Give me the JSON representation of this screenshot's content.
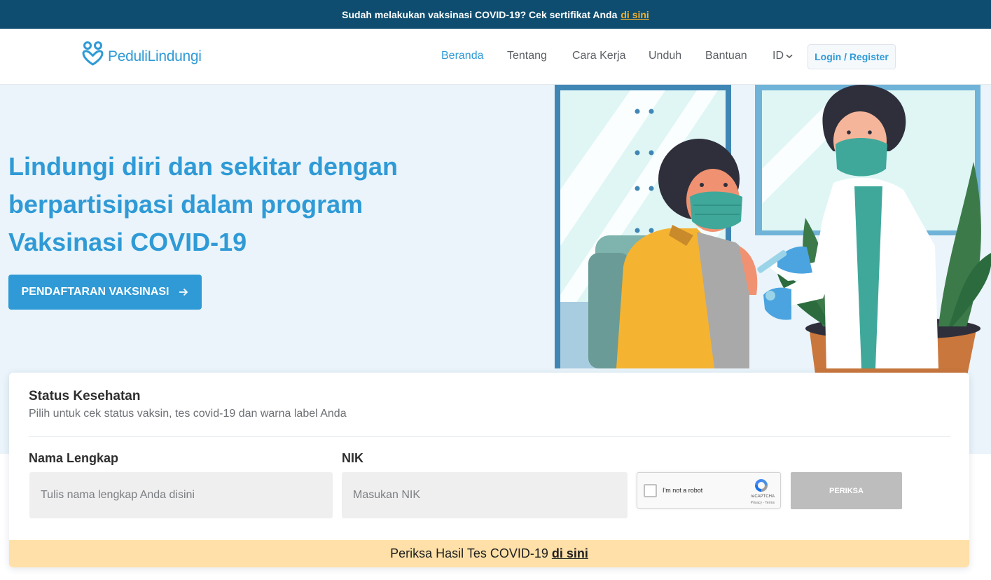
{
  "banner": {
    "text": "Sudah melakukan vaksinasi COVID-19? Cek sertifikat Anda",
    "link": "di sini"
  },
  "nav": {
    "brand": "PeduliLindungi",
    "items": [
      {
        "label": "Beranda",
        "active": true
      },
      {
        "label": "Tentang"
      },
      {
        "label": "Cara Kerja"
      },
      {
        "label": "Unduh"
      },
      {
        "label": "Bantuan"
      }
    ],
    "language": "ID",
    "login": "Login / Register"
  },
  "hero": {
    "title_lines": [
      "Lindungi diri dan sekitar dengan",
      "berpartisipasi dalam program",
      "Vaksinasi COVID-19"
    ],
    "cta": "PENDAFTARAN VAKSINASI"
  },
  "status": {
    "title": "Status Kesehatan",
    "subtitle": "Pilih untuk cek status vaksin, tes covid-19 dan warna label Anda",
    "name_label": "Nama Lengkap",
    "name_placeholder": "Tulis nama lengkap Anda disini",
    "nik_label": "NIK",
    "nik_placeholder": "Masukan NIK",
    "captcha_text": "I'm not a robot",
    "captcha_brand": "reCAPTCHA",
    "captcha_terms": "Privacy - Terms",
    "check_button": "PERIKSA",
    "result_text": "Periksa Hasil Tes COVID-19",
    "result_link": "di sini"
  },
  "colors": {
    "primary": "#2f9ad6",
    "banner_bg": "#0e4d6f",
    "banner_link": "#f5b12a",
    "hero_bg": "#eaf4fa",
    "result_bar": "#ffe0a8"
  }
}
